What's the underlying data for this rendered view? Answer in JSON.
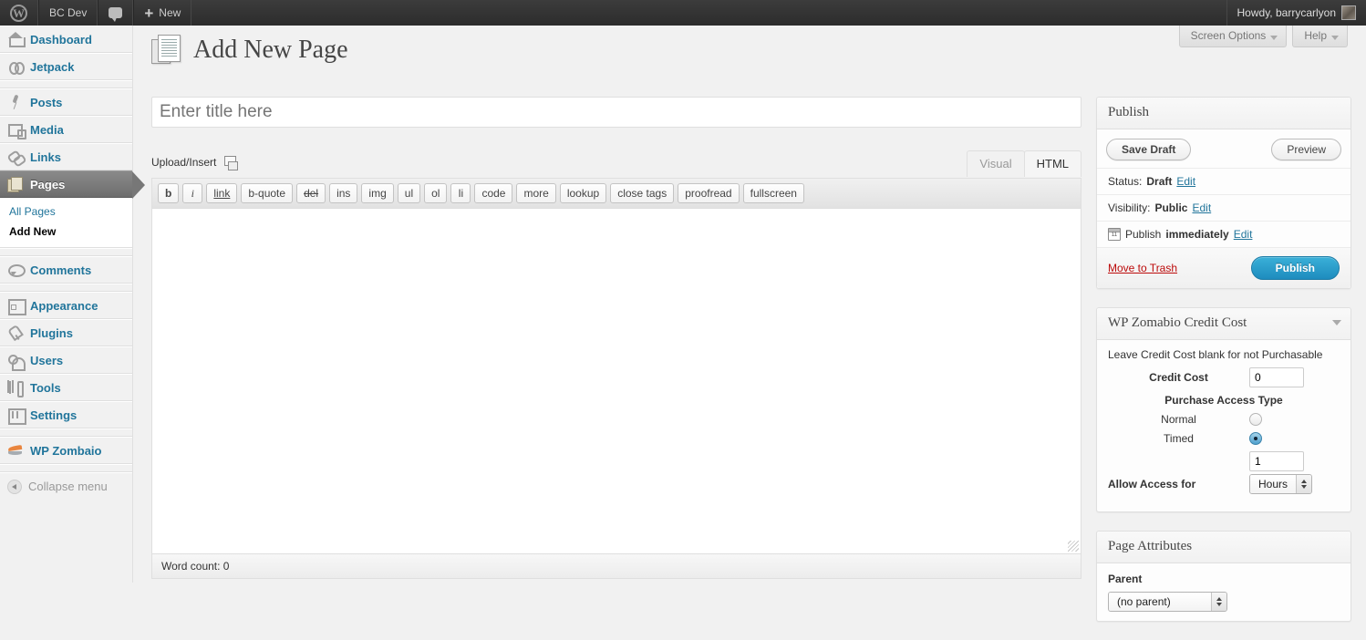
{
  "adminbar": {
    "logo_icon": "wordpress-logo-icon",
    "site_name": "BC Dev",
    "comments_icon": "comment-bubble-icon",
    "new_plus_icon": "plus-icon",
    "new_label": "New",
    "howdy": "Howdy, barrycarlyon",
    "avatar_icon": "avatar"
  },
  "screen_meta": {
    "screen_options": "Screen Options",
    "help": "Help"
  },
  "sidebar": {
    "items": [
      {
        "label": "Dashboard",
        "icon": "dashboard-icon",
        "icon_class": "ic-dash",
        "current": false
      },
      {
        "label": "Jetpack",
        "icon": "jetpack-icon",
        "icon_class": "ic-jet",
        "current": false
      },
      {
        "label": "Posts",
        "icon": "pin-icon",
        "icon_class": "ic-post",
        "current": false
      },
      {
        "label": "Media",
        "icon": "media-icon",
        "icon_class": "ic-media",
        "current": false
      },
      {
        "label": "Links",
        "icon": "link-chain-icon",
        "icon_class": "ic-link",
        "current": false
      },
      {
        "label": "Pages",
        "icon": "pages-icon",
        "icon_class": "ic-pages",
        "current": true
      },
      {
        "label": "Comments",
        "icon": "comment-icon",
        "icon_class": "ic-comm",
        "current": false
      },
      {
        "label": "Appearance",
        "icon": "appearance-icon",
        "icon_class": "ic-appear",
        "current": false
      },
      {
        "label": "Plugins",
        "icon": "plugin-icon",
        "icon_class": "ic-plug",
        "current": false
      },
      {
        "label": "Users",
        "icon": "users-icon",
        "icon_class": "ic-users",
        "current": false
      },
      {
        "label": "Tools",
        "icon": "tools-icon",
        "icon_class": "ic-tools",
        "current": false
      },
      {
        "label": "Settings",
        "icon": "settings-icon",
        "icon_class": "ic-set",
        "current": false
      },
      {
        "label": "WP Zombaio",
        "icon": "zombaio-icon",
        "icon_class": "ic-zomb",
        "current": false
      }
    ],
    "submenu": [
      {
        "label": "All Pages",
        "current": false
      },
      {
        "label": "Add New",
        "current": true
      }
    ],
    "collapse": {
      "label": "Collapse menu",
      "icon": "collapse-arrow-icon"
    }
  },
  "page": {
    "heading": "Add New Page",
    "heading_icon": "page-document-icon",
    "title_placeholder": "Enter title here",
    "title_value": ""
  },
  "editor": {
    "upload_label": "Upload/Insert",
    "upload_icon": "add-media-icon",
    "tabs": [
      {
        "label": "Visual",
        "active": false
      },
      {
        "label": "HTML",
        "active": true
      }
    ],
    "quicktags": [
      "b",
      "i",
      "link",
      "b-quote",
      "del",
      "ins",
      "img",
      "ul",
      "ol",
      "li",
      "code",
      "more",
      "lookup",
      "close tags",
      "proofread",
      "fullscreen"
    ],
    "content": "",
    "word_count": "Word count: 0"
  },
  "publish": {
    "title": "Publish",
    "save_draft": "Save Draft",
    "preview": "Preview",
    "status_label": "Status:",
    "status_value": "Draft",
    "status_edit": "Edit",
    "visibility_label": "Visibility:",
    "visibility_value": "Public",
    "visibility_edit": "Edit",
    "schedule_icon": "calendar-icon",
    "schedule_label": "Publish",
    "schedule_value": "immediately",
    "schedule_edit": "Edit",
    "trash": "Move to Trash",
    "publish_button": "Publish",
    "publish_color": "#2ea2cc",
    "trash_color": "#bc0b0b"
  },
  "zomabio": {
    "title": "WP Zomabio Credit Cost",
    "toggle_icon": "chevron-down-icon",
    "note": "Leave Credit Cost blank for not Purchasable",
    "credit_cost_label": "Credit Cost",
    "credit_cost_value": "0",
    "access_type_label": "Purchase Access Type",
    "normal_label": "Normal",
    "normal_checked": false,
    "timed_label": "Timed",
    "timed_checked": true,
    "allow_access_label": "Allow Access for",
    "allow_access_value": "1",
    "allow_access_unit": "Hours"
  },
  "page_attributes": {
    "title": "Page Attributes",
    "parent_label": "Parent",
    "parent_value": "(no parent)"
  }
}
